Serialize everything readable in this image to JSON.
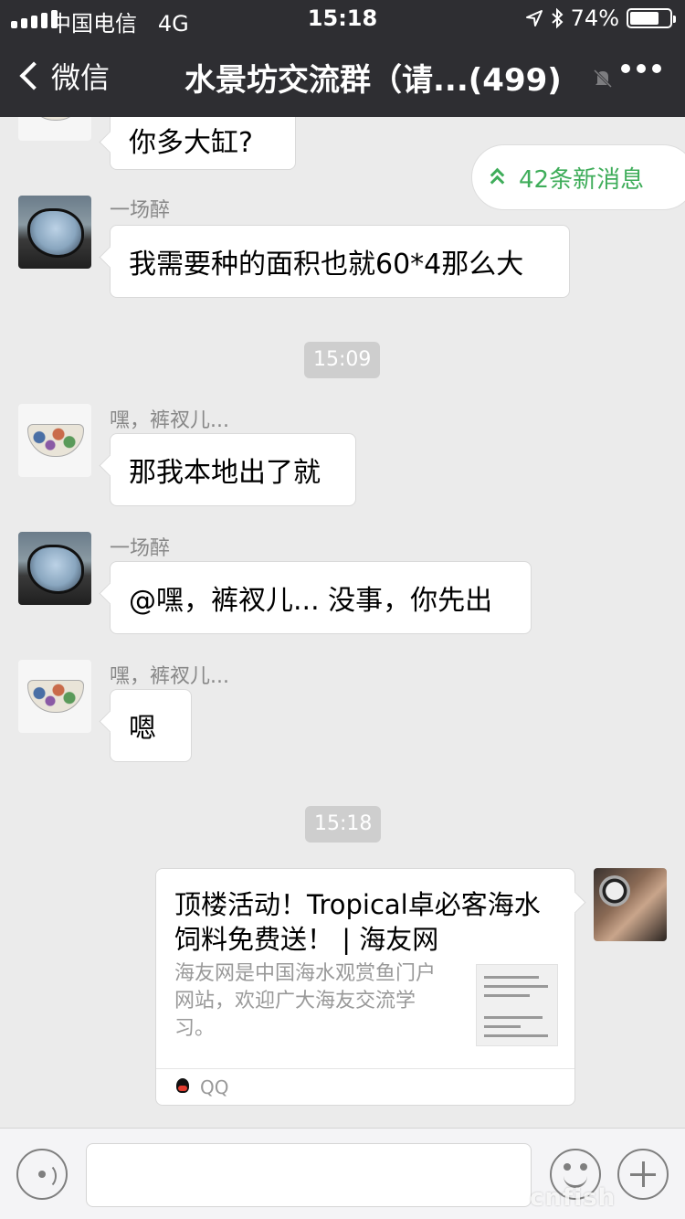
{
  "status_bar": {
    "carrier": "中国电信",
    "network": "4G",
    "time": "15:18",
    "battery_percent": "74%",
    "battery_level": 0.74
  },
  "nav": {
    "back_label": "微信",
    "title": "水景坊交流群（请...(499)"
  },
  "new_messages_label": "42条新消息",
  "messages": [
    {
      "text": "你多大缸?"
    },
    {
      "sender": "一场醉",
      "text": "我需要种的面积也就60*4那么大"
    },
    {
      "timestamp": "15:09"
    },
    {
      "sender": "嘿，裤衩儿...",
      "text": "那我本地出了就"
    },
    {
      "sender": "一场醉",
      "text": "@嘿，裤衩儿... 没事，你先出"
    },
    {
      "sender": "嘿，裤衩儿...",
      "text": "嗯"
    },
    {
      "timestamp": "15:18"
    }
  ],
  "link_card": {
    "title": "顶楼活动！Tropical卓必客海水饲料免费送！ | 海友网",
    "description": "海友网是中国海水观赏鱼门户网站，欢迎广大海友交流学习。",
    "source": "QQ"
  },
  "watermark": "cnfish"
}
